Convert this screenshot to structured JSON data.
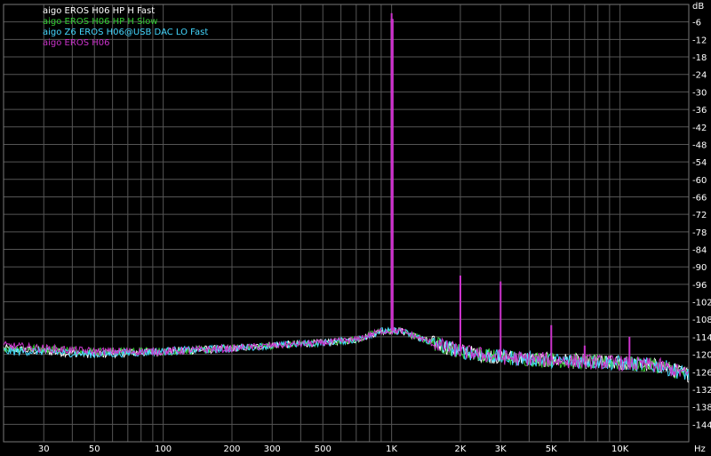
{
  "chart_data": {
    "type": "line",
    "x_scale": "log",
    "xlim": [
      20,
      20000
    ],
    "ylim": [
      -150,
      0
    ],
    "xlabel_unit": "Hz",
    "ylabel_unit": "dB",
    "grid": true,
    "legend_position": "top-left",
    "x_tick_labels": [
      {
        "value": 30,
        "label": "30"
      },
      {
        "value": 50,
        "label": "50"
      },
      {
        "value": 100,
        "label": "100"
      },
      {
        "value": 200,
        "label": "200"
      },
      {
        "value": 300,
        "label": "300"
      },
      {
        "value": 500,
        "label": "500"
      },
      {
        "value": 1000,
        "label": "1K"
      },
      {
        "value": 2000,
        "label": "2K"
      },
      {
        "value": 3000,
        "label": "3K"
      },
      {
        "value": 5000,
        "label": "5K"
      },
      {
        "value": 10000,
        "label": "10K"
      }
    ],
    "y_ticks": [
      -6,
      -12,
      -18,
      -24,
      -30,
      -36,
      -42,
      -48,
      -54,
      -60,
      -66,
      -72,
      -78,
      -84,
      -90,
      -96,
      -102,
      -108,
      -114,
      -120,
      -126,
      -132,
      -138,
      -144
    ],
    "series": [
      {
        "name": "aigo EROS H06 HP H Fast",
        "color": "#ffffff",
        "points": [
          [
            20,
            -118
          ],
          [
            30,
            -119
          ],
          [
            50,
            -120
          ],
          [
            100,
            -119
          ],
          [
            200,
            -118
          ],
          [
            300,
            -117
          ],
          [
            500,
            -116
          ],
          [
            700,
            -115
          ],
          [
            900,
            -112
          ],
          [
            1000,
            -5
          ],
          [
            1100,
            -112
          ],
          [
            1500,
            -116
          ],
          [
            2000,
            -119
          ],
          [
            3000,
            -121
          ],
          [
            5000,
            -122
          ],
          [
            10000,
            -123
          ],
          [
            15000,
            -124
          ],
          [
            20000,
            -127
          ]
        ],
        "peaks": []
      },
      {
        "name": "aigo EROS H06 HP H Slow",
        "color": "#33cc33",
        "points": [
          [
            20,
            -118
          ],
          [
            30,
            -118
          ],
          [
            50,
            -119
          ],
          [
            100,
            -119
          ],
          [
            200,
            -118
          ],
          [
            300,
            -117
          ],
          [
            500,
            -116
          ],
          [
            700,
            -115
          ],
          [
            900,
            -112
          ],
          [
            1000,
            -5
          ],
          [
            1100,
            -112
          ],
          [
            1500,
            -116
          ],
          [
            2000,
            -119
          ],
          [
            3000,
            -121
          ],
          [
            5000,
            -122
          ],
          [
            10000,
            -123
          ],
          [
            15000,
            -124
          ],
          [
            20000,
            -127
          ]
        ],
        "peaks": []
      },
      {
        "name": "aigo Z6 EROS H06@USB DAC LO Fast",
        "color": "#44d8ff",
        "points": [
          [
            20,
            -119
          ],
          [
            30,
            -119
          ],
          [
            50,
            -120
          ],
          [
            100,
            -119
          ],
          [
            200,
            -118
          ],
          [
            300,
            -117
          ],
          [
            500,
            -116
          ],
          [
            700,
            -115
          ],
          [
            900,
            -112
          ],
          [
            1000,
            -5
          ],
          [
            1100,
            -112
          ],
          [
            1500,
            -116
          ],
          [
            2000,
            -119
          ],
          [
            3000,
            -121
          ],
          [
            5000,
            -122
          ],
          [
            10000,
            -123
          ],
          [
            15000,
            -124
          ],
          [
            20000,
            -127
          ]
        ],
        "peaks": []
      },
      {
        "name": "aigo EROS H06",
        "color": "#cc33cc",
        "points": [
          [
            20,
            -117
          ],
          [
            30,
            -118
          ],
          [
            50,
            -119
          ],
          [
            100,
            -119
          ],
          [
            200,
            -118
          ],
          [
            300,
            -117
          ],
          [
            500,
            -116
          ],
          [
            700,
            -115
          ],
          [
            900,
            -112
          ],
          [
            1000,
            -5
          ],
          [
            1100,
            -112
          ],
          [
            1500,
            -116
          ],
          [
            2000,
            -119
          ],
          [
            3000,
            -121
          ],
          [
            5000,
            -122
          ],
          [
            10000,
            -123
          ],
          [
            15000,
            -124
          ],
          [
            20000,
            -127
          ]
        ],
        "peaks": [
          [
            1000,
            -3
          ],
          [
            2000,
            -93
          ],
          [
            3000,
            -95
          ],
          [
            5000,
            -110
          ],
          [
            7000,
            -117
          ],
          [
            11000,
            -114
          ]
        ]
      }
    ]
  }
}
